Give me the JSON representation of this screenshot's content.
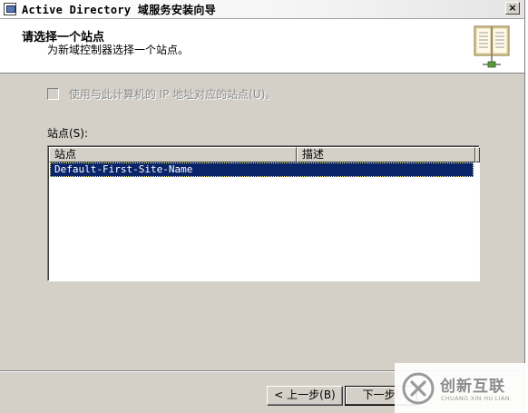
{
  "window": {
    "title": "Active Directory 域服务安装向导",
    "close_label": "×"
  },
  "header": {
    "title": "请选择一个站点",
    "subtitle": "为新域控制器选择一个站点。",
    "icon": "book-icon"
  },
  "options": {
    "use_ip_site_label": "使用与此计算机的 IP 地址对应的站点(U)。",
    "use_ip_site_checked": false,
    "use_ip_site_enabled": false
  },
  "sites": {
    "label": "站点(S):",
    "columns": [
      "站点",
      "描述"
    ],
    "rows": [
      {
        "site": "Default-First-Site-Name",
        "description": "",
        "selected": true
      }
    ]
  },
  "buttons": {
    "back": "< 上一步(B)",
    "next": "下一步("
  },
  "watermark": {
    "cn": "创新互联",
    "en": "CHUANG XIN HU LIAN"
  },
  "colors": {
    "dialog_bg": "#d4d0c8",
    "selection": "#0a246a",
    "header_bg": "#ffffff"
  }
}
